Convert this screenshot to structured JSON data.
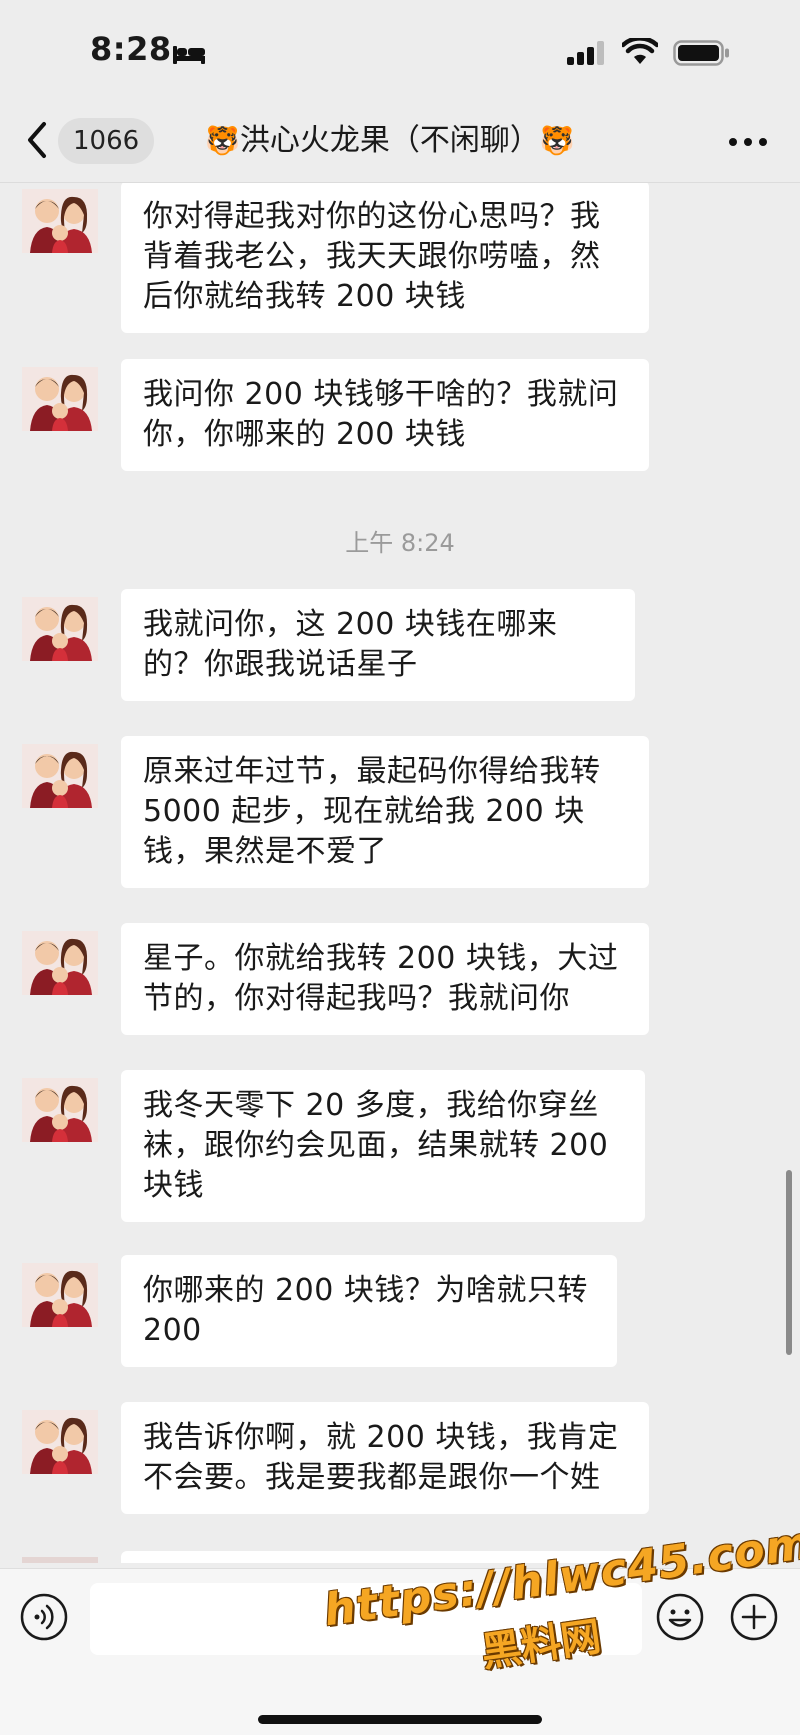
{
  "status_bar": {
    "time": "8:28",
    "icons": [
      "bed-icon",
      "signal-icon",
      "wifi-icon",
      "battery-icon"
    ]
  },
  "nav": {
    "back_icon": "chevron-left-icon",
    "unread_count": "1066",
    "title_emoji": "🐯",
    "title": "洪心火龙果（不闲聊）",
    "more_icon": "more-dots-icon"
  },
  "messages": [
    {
      "type": "text",
      "sender": "other",
      "text": "你对得起我对你的这份心思吗？我背着我老公，我天天跟你唠嗑，然后你就给我转 200 块钱"
    },
    {
      "type": "text",
      "sender": "other",
      "text": "我问你 200 块钱够干啥的？我就问你，你哪来的 200 块钱"
    },
    {
      "type": "timestamp",
      "text": "上午 8:24"
    },
    {
      "type": "text",
      "sender": "other",
      "text": "我就问你，这 200 块钱在哪来的？你跟我说话星子"
    },
    {
      "type": "text",
      "sender": "other",
      "text": "原来过年过节，最起码你得给我转 5000 起步，现在就给我 200 块钱，果然是不爱了"
    },
    {
      "type": "text",
      "sender": "other",
      "text": "星子。你就给我转 200 块钱，大过节的，你对得起我吗？我就问你"
    },
    {
      "type": "text",
      "sender": "other",
      "text": "我冬天零下 20 多度，我给你穿丝袜，跟你约会见面，结果就转 200 块钱"
    },
    {
      "type": "text",
      "sender": "other",
      "text": "你哪来的 200 块钱？为啥就只转 200"
    },
    {
      "type": "text",
      "sender": "other",
      "text": "我告诉你啊，就 200 块钱，我肯定不会要。我是要我都是跟你一个姓"
    }
  ],
  "input_bar": {
    "voice_icon": "voice-icon",
    "input_value": "",
    "emoji_icon": "emoji-icon",
    "plus_icon": "plus-icon"
  },
  "watermark": {
    "url": "https://hlwc45.com",
    "name": "黑料网"
  },
  "colors": {
    "background": "#ededed",
    "bubble": "#ffffff",
    "text": "#1a1a1a",
    "timestamp": "#9a9a9a",
    "watermark": "#f5a623"
  }
}
